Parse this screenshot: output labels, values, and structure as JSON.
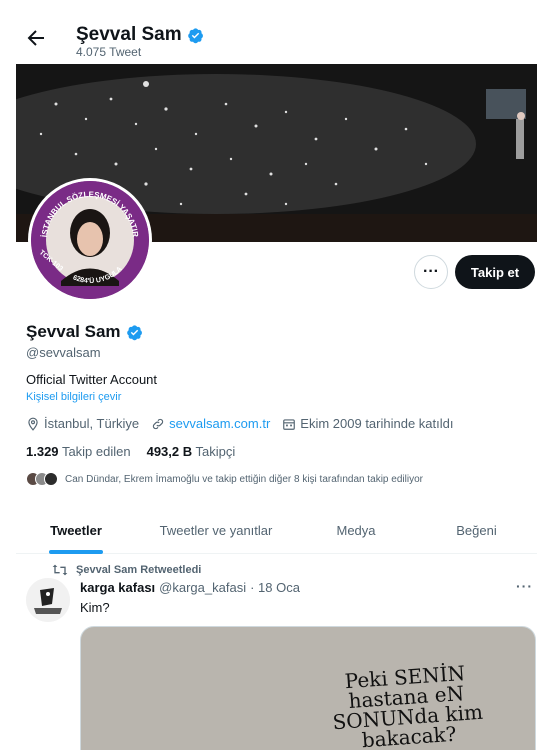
{
  "header": {
    "name": "Şevval Sam",
    "tweet_count": "4.075 Tweet"
  },
  "profile": {
    "name": "Şevval Sam",
    "handle": "@sevvalsam",
    "bio": "Official Twitter Account",
    "translate_link": "Kişisel bilgileri çevir",
    "location": "İstanbul, Türkiye",
    "website": "sevvalsam.com.tr",
    "joined": "Ekim 2009 tarihinde katıldı",
    "following_count": "1.329",
    "following_label": "Takip edilen",
    "followers_count": "493,2 B",
    "followers_label": "Takipçi",
    "followers_you_know": "Can Dündar, Ekrem İmamoğlu ve takip ettiğin diğer 8 kişi tarafından takip ediliyor",
    "avatar_ring_text": "İSTANBUL SÖZLEŞMESİ YAŞATIR",
    "avatar_ring_text_bottom": "6284'Ü UYGULA",
    "avatar_ring_text_left": "TCK-103"
  },
  "actions": {
    "more_label": "···",
    "follow_label": "Takip et"
  },
  "tabs": [
    {
      "label": "Tweetler",
      "active": true
    },
    {
      "label": "Tweetler ve yanıtlar",
      "active": false
    },
    {
      "label": "Medya",
      "active": false
    },
    {
      "label": "Beğeni",
      "active": false
    }
  ],
  "tweet": {
    "retweet_label": "Şevval Sam Retweetledi",
    "author_name": "karga kafası",
    "author_handle": "@karga_kafasi",
    "date": "· 18 Oca",
    "more_label": "···",
    "text": "Kim?",
    "media_text": "Peki SENİN hastana eN SONUNda kim bakacak?"
  },
  "colors": {
    "accent": "#1d9bf0",
    "avatar_ring": "#7a2b86",
    "follow_button": "#0f1419"
  }
}
